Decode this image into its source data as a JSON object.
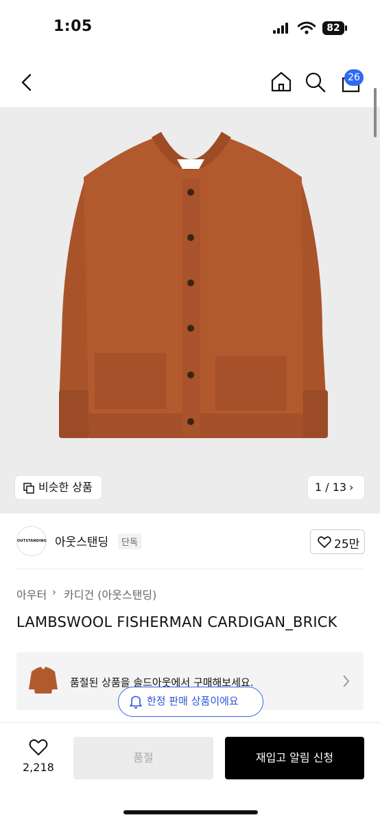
{
  "status": {
    "time": "1:05",
    "battery": "82"
  },
  "header": {
    "cart_count": "26"
  },
  "gallery": {
    "similar_label": "비슷한 상품",
    "counter": "1 / 13"
  },
  "brand": {
    "logo_text": "OUTSTANDING",
    "name": "아웃스탠딩",
    "tag": "단독",
    "likes": "25만"
  },
  "breadcrumb": {
    "level1": "아우터",
    "level2": "카디건 (아웃스탠딩)"
  },
  "product": {
    "title": "LAMBSWOOL FISHERMAN CARDIGAN_BRICK"
  },
  "soldout_banner": {
    "text": "품절된 상품을 솔드아웃에서 구매해보세요.",
    "limited": "한정 판매 상품이에요"
  },
  "bottom_bar": {
    "wish_count": "2,218",
    "soldout_label": "품절",
    "restock_label": "재입고 알림 신청"
  },
  "colors": {
    "accent_blue": "#2f6bf2",
    "sweater": "#b25a2e"
  }
}
